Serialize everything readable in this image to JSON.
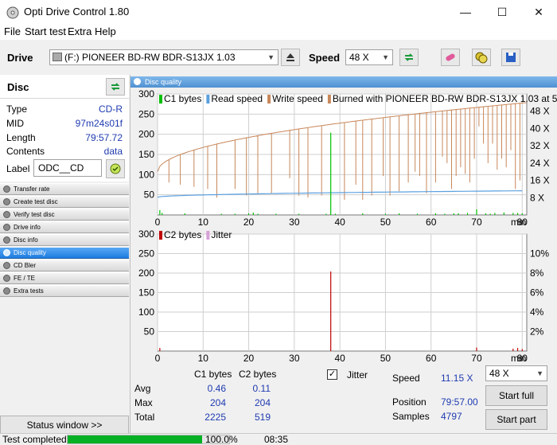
{
  "window": {
    "title": "Opti Drive Control 1.80",
    "minimize_glyph": "—",
    "maximize_glyph": "☐",
    "close_glyph": "✕"
  },
  "menu": [
    "File",
    "Start test",
    "Extra",
    "Help"
  ],
  "toolbar": {
    "drive_label": "Drive",
    "drive_value": "(F:)   PIONEER BD-RW  BDR-S13JX 1.03",
    "speed_label": "Speed",
    "speed_value": "48 X"
  },
  "disc": {
    "header": "Disc",
    "rows": [
      {
        "label": "Type",
        "value": "CD-R"
      },
      {
        "label": "MID",
        "value": "97m24s01f"
      },
      {
        "label": "Length",
        "value": "79:57.72"
      },
      {
        "label": "Contents",
        "value": "data"
      }
    ],
    "label_label": "Label",
    "label_value": "ODC__CD"
  },
  "nav": [
    {
      "label": "Transfer rate",
      "active": false
    },
    {
      "label": "Create test disc",
      "active": false
    },
    {
      "label": "Verify test disc",
      "active": false
    },
    {
      "label": "Drive info",
      "active": false
    },
    {
      "label": "Disc info",
      "active": false
    },
    {
      "label": "Disc quality",
      "active": true
    },
    {
      "label": "CD Bler",
      "active": false
    },
    {
      "label": "FE / TE",
      "active": false
    },
    {
      "label": "Extra tests",
      "active": false
    }
  ],
  "status_window_label": "Status window >>",
  "panel_title": "Disc quality",
  "chart_data": [
    {
      "type": "line",
      "legend": [
        "C1 bytes",
        "Read speed",
        "Write speed",
        "Burned with PIONEER BD-RW  BDR-S13JX 1.03 at 51X"
      ],
      "series_colors": {
        "c1": "#00c000",
        "read": "#5aa0e0",
        "write": "#c8875a"
      },
      "x_ticks": [
        0,
        10,
        20,
        30,
        40,
        50,
        60,
        70,
        80
      ],
      "x_unit": "min",
      "xlim": [
        0,
        81
      ],
      "y_ticks": [
        50,
        100,
        150,
        200,
        250,
        300
      ],
      "ylim": [
        0,
        300
      ],
      "y2_ticks": [
        "8 X",
        "16 X",
        "24 X",
        "32 X",
        "40 X",
        "48 X"
      ],
      "write_speed": {
        "start": 20,
        "end": 52
      },
      "read_speed": {
        "start": 8.2,
        "end": 11.2
      },
      "write_dips": [
        [
          2.5,
          15
        ],
        [
          5,
          14
        ],
        [
          8,
          13
        ],
        [
          11,
          12
        ],
        [
          13,
          8
        ],
        [
          17,
          12
        ],
        [
          19.5,
          9
        ],
        [
          22,
          10
        ],
        [
          25,
          10
        ],
        [
          29,
          17
        ],
        [
          31,
          9
        ],
        [
          33,
          8
        ],
        [
          36,
          9
        ],
        [
          41,
          7
        ],
        [
          43.5,
          14
        ],
        [
          45,
          7
        ],
        [
          47,
          9
        ],
        [
          49.5,
          18
        ],
        [
          51,
          9
        ],
        [
          53,
          11
        ],
        [
          55,
          15
        ],
        [
          56.5,
          20
        ],
        [
          57.5,
          18
        ],
        [
          59,
          10
        ],
        [
          61,
          15
        ],
        [
          62.5,
          27
        ],
        [
          63.5,
          24
        ],
        [
          64.5,
          12
        ],
        [
          65.5,
          18
        ],
        [
          66.5,
          22
        ],
        [
          67.5,
          19
        ],
        [
          68.5,
          15
        ],
        [
          69.5,
          26
        ],
        [
          70.5,
          41
        ],
        [
          71.5,
          33
        ],
        [
          72.5,
          24
        ],
        [
          73.5,
          33
        ],
        [
          74.5,
          21
        ],
        [
          75.5,
          26
        ],
        [
          76.5,
          22
        ],
        [
          77.5,
          30
        ],
        [
          78.5,
          12
        ],
        [
          79.5,
          16
        ]
      ],
      "c1_spikes": [
        [
          0.5,
          12
        ],
        [
          1,
          5
        ],
        [
          6,
          4
        ],
        [
          14,
          3
        ],
        [
          17,
          3
        ],
        [
          20,
          4
        ],
        [
          21,
          6
        ],
        [
          22,
          3
        ],
        [
          26,
          3
        ],
        [
          31,
          3
        ],
        [
          37,
          3
        ],
        [
          38,
          204
        ],
        [
          39,
          3
        ],
        [
          45,
          4
        ],
        [
          50,
          3
        ],
        [
          53,
          4
        ],
        [
          57,
          3
        ],
        [
          61,
          4
        ],
        [
          63,
          3
        ],
        [
          65,
          4
        ],
        [
          66,
          4
        ],
        [
          68,
          5
        ],
        [
          70,
          14
        ],
        [
          72,
          4
        ],
        [
          73,
          3
        ],
        [
          74,
          5
        ],
        [
          76,
          6
        ],
        [
          78,
          5
        ],
        [
          79,
          5
        ],
        [
          80,
          4
        ]
      ]
    },
    {
      "type": "line",
      "legend": [
        "C2 bytes",
        "Jitter"
      ],
      "series_colors": {
        "c2": "#c00000",
        "jitter": "#d8a0d8"
      },
      "x_ticks": [
        0,
        10,
        20,
        30,
        40,
        50,
        60,
        70,
        80
      ],
      "x_unit": "min",
      "xlim": [
        0,
        81
      ],
      "y_ticks": [
        50,
        100,
        150,
        200,
        250,
        300
      ],
      "ylim": [
        0,
        300
      ],
      "y2_ticks": [
        "2%",
        "4%",
        "6%",
        "8%",
        "10%"
      ],
      "c2_spikes": [
        [
          0.5,
          8
        ],
        [
          38,
          204
        ],
        [
          70,
          9
        ],
        [
          78,
          6
        ],
        [
          79,
          8
        ],
        [
          80,
          5
        ]
      ]
    }
  ],
  "stats": {
    "col_c1": "C1 bytes",
    "col_c2": "C2 bytes",
    "rows": [
      {
        "label": "Avg",
        "c1": "0.46",
        "c2": "0.11"
      },
      {
        "label": "Max",
        "c1": "204",
        "c2": "204"
      },
      {
        "label": "Total",
        "c1": "2225",
        "c2": "519"
      }
    ],
    "jitter_label": "Jitter",
    "jitter_checked": "✓",
    "speed_label": "Speed",
    "speed_value": "11.15 X",
    "position_label": "Position",
    "position_value": "79:57.00",
    "samples_label": "Samples",
    "samples_value": "4797",
    "speed_select": "48 X",
    "start_full": "Start full",
    "start_part": "Start part"
  },
  "statusbar": {
    "text": "Test completed",
    "progress_percent": 100,
    "progress_label": "100.0%",
    "time": "08:35"
  }
}
